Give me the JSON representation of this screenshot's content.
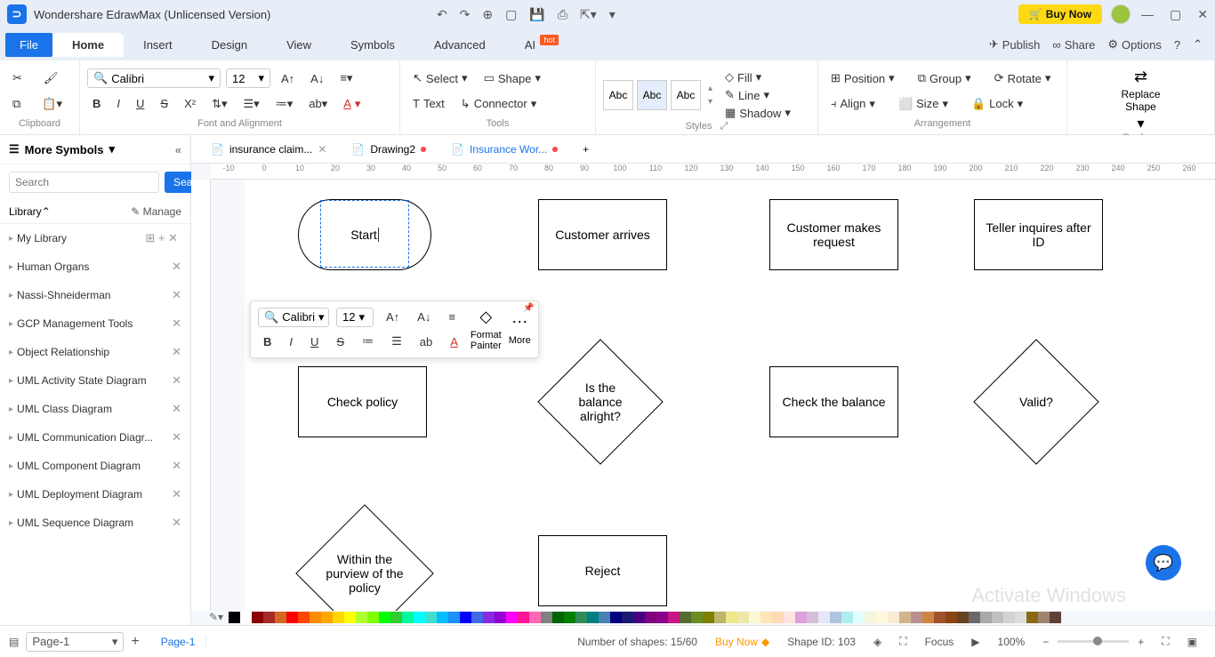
{
  "titlebar": {
    "app_title": "Wondershare EdrawMax (Unlicensed Version)",
    "buy_now": "Buy Now"
  },
  "menu": {
    "file": "File",
    "items": [
      "Home",
      "Insert",
      "Design",
      "View",
      "Symbols",
      "Advanced",
      "AI"
    ],
    "right": {
      "publish": "Publish",
      "share": "Share",
      "options": "Options"
    }
  },
  "ribbon": {
    "font_name": "Calibri",
    "font_size": "12",
    "select": "Select",
    "shape": "Shape",
    "text": "Text",
    "connector": "Connector",
    "style_abc": "Abc",
    "fill": "Fill",
    "line": "Line",
    "shadow": "Shadow",
    "position": "Position",
    "align": "Align",
    "group": "Group",
    "size": "Size",
    "rotate": "Rotate",
    "lock": "Lock",
    "replace_shape": "Replace\nShape",
    "groups": {
      "clipboard": "Clipboard",
      "font": "Font and Alignment",
      "tools": "Tools",
      "styles": "Styles",
      "arrangement": "Arrangement",
      "replace": "Replace"
    }
  },
  "left_panel": {
    "more_symbols": "More Symbols",
    "search_placeholder": "Search",
    "search_btn": "Search",
    "library": "Library",
    "manage": "Manage",
    "items": [
      "My Library",
      "Human Organs",
      "Nassi-Shneiderman",
      "GCP Management Tools",
      "Object Relationship",
      "UML Activity State Diagram",
      "UML Class Diagram",
      "UML Communication Diagr...",
      "UML Component Diagram",
      "UML Deployment Diagram",
      "UML Sequence Diagram"
    ]
  },
  "tabs": [
    {
      "label": "insurance claim...",
      "active": false,
      "dirty": false,
      "closable": true
    },
    {
      "label": "Drawing2",
      "active": false,
      "dirty": true,
      "closable": false
    },
    {
      "label": "Insurance Wor...",
      "active": true,
      "dirty": true,
      "closable": false
    }
  ],
  "ruler_start": -10,
  "ruler_end": 280,
  "shapes": {
    "start": "Start",
    "customer_arrives": "Customer arrives",
    "customer_request": "Customer makes request",
    "teller_inquires": "Teller inquires after ID",
    "check_policy": "Check policy",
    "balance_ok": "Is the balance alright?",
    "check_balance": "Check the balance",
    "valid": "Valid?",
    "within_purview": "Within the purview of the policy",
    "reject": "Reject"
  },
  "float_toolbar": {
    "font": "Calibri",
    "size": "12",
    "format_painter": "Format\nPainter",
    "more": "More"
  },
  "colors": [
    "#000",
    "#fff",
    "#8b0000",
    "#a52a2a",
    "#d2691e",
    "#ff0000",
    "#ff4500",
    "#ff8c00",
    "#ffa500",
    "#ffd700",
    "#ffff00",
    "#adff2f",
    "#7fff00",
    "#00ff00",
    "#32cd32",
    "#00fa9a",
    "#00ffff",
    "#40e0d0",
    "#00bfff",
    "#1e90ff",
    "#0000ff",
    "#4169e1",
    "#8a2be2",
    "#9400d3",
    "#ff00ff",
    "#ff1493",
    "#ff69b4",
    "#808080",
    "#006400",
    "#008000",
    "#2e8b57",
    "#008080",
    "#4682b4",
    "#000080",
    "#191970",
    "#4b0082",
    "#800080",
    "#8b008b",
    "#c71585",
    "#556b2f",
    "#6b8e23",
    "#808000",
    "#bdb76b",
    "#f0e68c",
    "#eee8aa",
    "#fafad2",
    "#ffe4b5",
    "#ffdab9",
    "#ffe4e1",
    "#dda0dd",
    "#d8bfd8",
    "#e6e6fa",
    "#b0c4de",
    "#afeeee",
    "#e0ffff",
    "#f5f5dc",
    "#fff8dc",
    "#faebd7",
    "#d2b48c",
    "#bc8f8f",
    "#cd853f",
    "#a0522d",
    "#8b4513",
    "#654321",
    "#696969",
    "#a9a9a9",
    "#c0c0c0",
    "#d3d3d3",
    "#dcdcdc",
    "#8B6914",
    "#A0826D",
    "#5D4037"
  ],
  "status": {
    "page_selector": "Page-1",
    "page_tab": "Page-1",
    "shapes_count": "Number of shapes: 15/60",
    "buy_now": "Buy Now",
    "shape_id": "Shape ID: 103",
    "focus": "Focus",
    "zoom": "100%"
  },
  "watermark": "Activate Windows"
}
